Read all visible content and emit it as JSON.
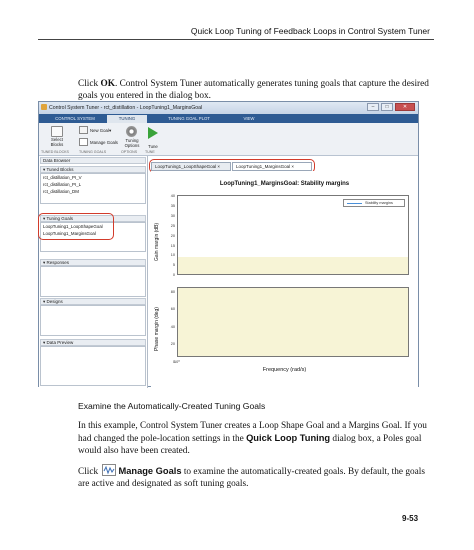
{
  "header": {
    "title": "Quick Loop Tuning of Feedback Loops in Control System Tuner"
  },
  "intro": {
    "pre": "Click ",
    "bold": "OK",
    "post": ". Control System Tuner automatically generates tuning goals that capture the desired goals you entered in the dialog box."
  },
  "window": {
    "title": "Control System Tuner - rct_distillation - LoopTuning1_MarginsGoal",
    "tabs": [
      "CONTROL SYSTEM",
      "TUNING",
      "TUNING GOAL PLOT",
      "VIEW"
    ],
    "toolstrip": {
      "select_blocks": "Select Blocks",
      "new_goal": "New Goal",
      "manage_goals": "Manage Goals",
      "tuning_options": "Tuning Options",
      "tune": "Tune",
      "group_tuned_blocks": "TUNED BLOCKS",
      "group_tuning_goals": "TUNING GOALS",
      "group_options": "OPTIONS",
      "group_tune": "TUNE"
    },
    "data_browser": {
      "title": "Data Browser",
      "tuned_blocks_header": "Tuned Blocks",
      "tuned_blocks": [
        "rct_distillation_PI_V",
        "rct_distillation_PI_L",
        "rct_distillation_DM"
      ],
      "tuning_goals_header": "Tuning Goals",
      "tuning_goals": [
        "LoopTuning1_LoopShapeGoal",
        "LoopTuning1_MarginsGoal"
      ],
      "responses_header": "Responses",
      "designs_header": "Designs",
      "preview_header": "Data Preview"
    },
    "doc_tabs": [
      "LoopTuning1_LoopShapeGoal",
      "LoopTuning1_MarginsGoal"
    ],
    "plot": {
      "title": "LoopTuning1_MarginsGoal: Stability margins",
      "legend": "Stability margins",
      "gain_ylabel": "Gain margin (dB)",
      "phase_ylabel": "Phase margin (deg)",
      "xlabel": "Frequency   (rad/s)",
      "gain_ticks": [
        "40",
        "35",
        "30",
        "25",
        "20",
        "15",
        "10",
        "5",
        "0"
      ],
      "phase_ticks": [
        "80",
        "60",
        "40",
        "20",
        "0"
      ],
      "x_tick": "10⁰"
    }
  },
  "section": {
    "heading": "Examine the Automatically-Created Tuning Goals"
  },
  "body1": {
    "pre": "In this example, Control System Tuner creates a Loop Shape Goal and a Margins Goal. If you had changed the pole-location settings in the ",
    "bold": "Quick Loop Tuning",
    "post": " dialog box, a Poles goal would also have been created."
  },
  "body2": {
    "pre": "Click ",
    "bold": "Manage Goals",
    "post": " to examine the automatically-created goals. By default, the goals are active and designated as soft tuning goals."
  },
  "footer": {
    "page": "9-53"
  },
  "colors": {
    "accent_tab": "#2e5b93",
    "highlight": "#d23b2b",
    "fill": "#f7f4d6",
    "legend_line": "#4a90d9"
  },
  "icons": [
    "select-blocks-icon",
    "new-goal-icon",
    "manage-goals-icon",
    "gear-icon",
    "play-icon",
    "triangle-down-icon",
    "close-icon"
  ]
}
